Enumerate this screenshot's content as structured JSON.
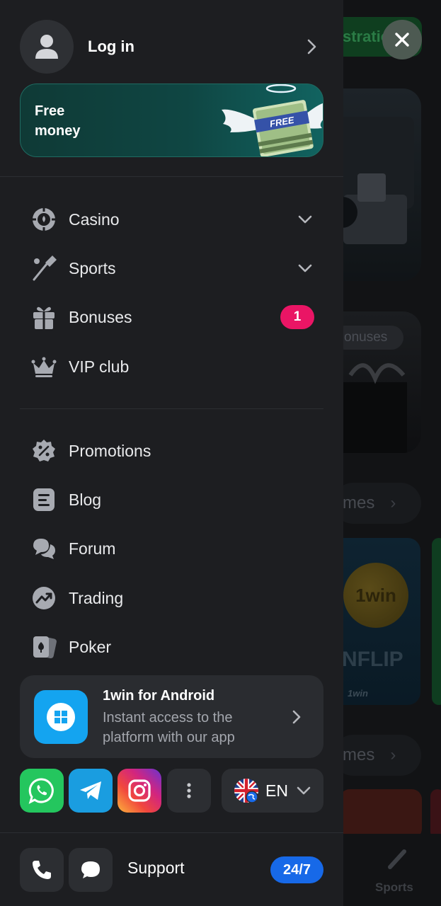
{
  "background": {
    "registration_fragment": "stratio",
    "bonuses_fragment": "onuses",
    "games_fragment_1": "mes",
    "games_fragment_2": "mes",
    "coinflip_logo": "1win",
    "coinflip_fragment": "NFLIP",
    "coinflip_brand": "1win",
    "nav_sports_label": "Sports"
  },
  "header": {
    "login_label": "Log in"
  },
  "promo": {
    "line1": "Free",
    "line2": "money",
    "art_label": "FREE"
  },
  "menu_primary": [
    {
      "label": "Casino",
      "icon": "casino-chip-icon",
      "has_dropdown": true
    },
    {
      "label": "Sports",
      "icon": "cricket-bat-icon",
      "has_dropdown": true
    },
    {
      "label": "Bonuses",
      "icon": "gift-icon",
      "badge": "1"
    },
    {
      "label": "VIP club",
      "icon": "crown-icon"
    }
  ],
  "menu_secondary": [
    {
      "label": "Promotions",
      "icon": "percent-badge-icon"
    },
    {
      "label": "Blog",
      "icon": "document-icon"
    },
    {
      "label": "Forum",
      "icon": "chat-bubbles-icon"
    },
    {
      "label": "Trading",
      "icon": "trend-up-icon"
    },
    {
      "label": "Poker",
      "icon": "cards-icon"
    }
  ],
  "app_card": {
    "title": "1win for Android",
    "subtitle": "Instant access to the platform with our app",
    "icon": "windows-logo-icon"
  },
  "social": [
    "whatsapp-icon",
    "telegram-icon",
    "instagram-icon",
    "more-vertical-icon"
  ],
  "language": {
    "code": "EN",
    "flag": "uk-flag-icon"
  },
  "support": {
    "label": "Support",
    "hours": "24/7"
  },
  "colors": {
    "drawer_bg": "#1d1e21",
    "badge_pink": "#ea1565",
    "support_blue": "#1769e8",
    "promo_teal": "#0f4643"
  }
}
